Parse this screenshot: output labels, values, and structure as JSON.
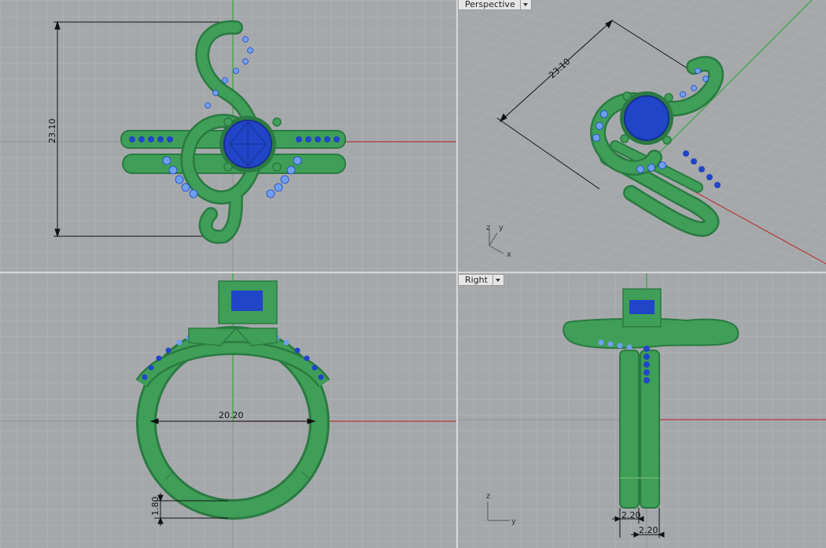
{
  "viewports": {
    "top": {
      "dimension": "23.10"
    },
    "perspective": {
      "label": "Perspective",
      "dimension": "23.10",
      "axis_z": "z",
      "axis_y": "y",
      "axis_x": "x"
    },
    "front": {
      "dimension_width": "20.20",
      "dimension_band": "1.80"
    },
    "right": {
      "label": "Right",
      "dimension_a": "2.20",
      "dimension_b": "2.20",
      "axis_z": "z",
      "axis_y": "y"
    }
  },
  "colors": {
    "viewport_bg": "#a5a8ab",
    "grid_minor": "#b4b7ba",
    "grid_major": "#8f9295",
    "x_axis": "#b43a3a",
    "y_axis": "#3aa63a",
    "metal_green": "#3f9e57",
    "metal_shade": "#2b7a42",
    "gem_blue": "#2145c8",
    "pave_blue": "#6fa0f0"
  }
}
